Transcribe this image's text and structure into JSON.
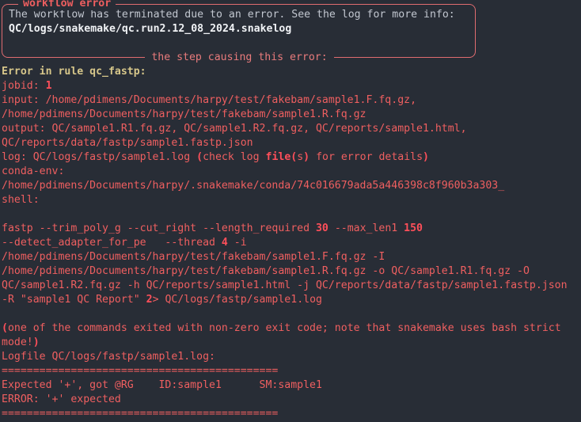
{
  "terminal": {
    "background_color": "#282d36",
    "default_text_color": "#ef5f60",
    "accent_khaki": "#d6c68a",
    "accent_hot": "#ff4f5a",
    "panel_border_color": "#e06c70",
    "panel_body_color": "#c2c7d0"
  },
  "panel": {
    "title": "workflow error",
    "footer_caption": "the step causing this error:",
    "message_line": "The workflow has terminated due to an error. See the log for more info:",
    "logfile_path": "QC/logs/snakemake/qc.run2.12_08_2024.snakelog"
  },
  "error": {
    "rule_header": "Error in rule qc_fastp:",
    "jobid_label": "jobid: ",
    "jobid_value": "1",
    "input_line1": "input: /home/pdimens/Documents/harpy/test/fakebam/sample1.F.fq.gz,",
    "input_line2": "/home/pdimens/Documents/harpy/test/fakebam/sample1.R.fq.gz",
    "output_line1": "output: QC/sample1.R1.fq.gz, QC/sample1.R2.fq.gz, QC/reports/sample1.html,",
    "output_line2": "QC/reports/data/fastp/sample1.fastp.json",
    "log_prefix": "log: QC/logs/fastp/sample1.log ",
    "log_paren_open": "(",
    "log_check": "check log ",
    "log_file_bold": "file",
    "log_paren2": "(",
    "log_s": "s",
    "log_paren3": ")",
    "log_rest": " for error details",
    "log_paren_close": ")",
    "conda_env_label": "conda-env:",
    "conda_env_path": "/home/pdimens/Documents/harpy/.snakemake/conda/74c016679ada5a446398c8f960b3a303_",
    "shell_label": "shell:"
  },
  "command": {
    "line1_a": "fastp --trim_poly_g --cut_right --length_required ",
    "line1_len": "30",
    "line1_b": " --max_len1 ",
    "line1_max": "150",
    "line2_a": "--detect_adapter_for_pe   --thread ",
    "line2_threads": "4",
    "line2_b": " -i",
    "line3": "/home/pdimens/Documents/harpy/test/fakebam/sample1.F.fq.gz -I",
    "line4": "/home/pdimens/Documents/harpy/test/fakebam/sample1.R.fq.gz -o QC/sample1.R1.fq.gz -O",
    "line5": "QC/sample1.R2.fq.gz -h QC/reports/sample1.html -j QC/reports/data/fastp/sample1.fastp.json",
    "line6_a": "-R \"sample1 QC Report\" ",
    "line6_fd": "2",
    "line6_b": "> QC/logs/fastp/sample1.log"
  },
  "footer": {
    "exit_paren_open": "(",
    "exit_message": "one of the commands exited with non-zero exit code; note that snakemake uses bash strict",
    "exit_message_line2": "mode!",
    "exit_paren_close": ")",
    "logfile_heading": "Logfile QC/logs/fastp/sample1.log:",
    "separator": "============================================",
    "log_error_line": "Expected '+', got @RG\tID:sample1\tSM:sample1",
    "log_error_line_rendered": "Expected '+', got @RG    ID:sample1      SM:sample1",
    "log_error_line2": "ERROR: '+' expected"
  }
}
